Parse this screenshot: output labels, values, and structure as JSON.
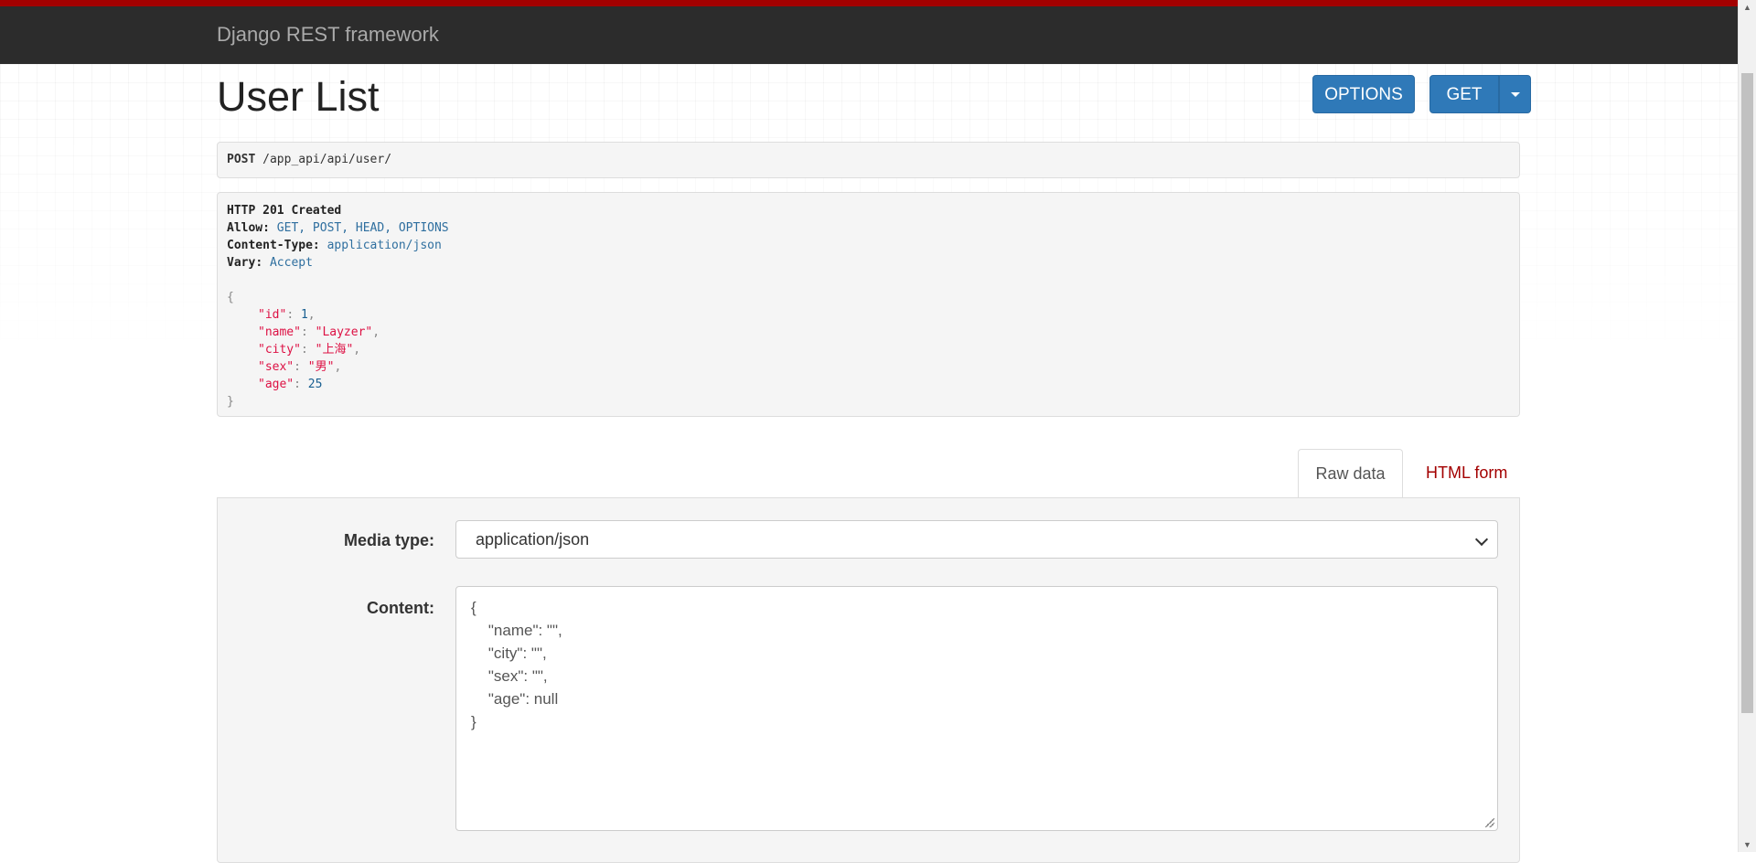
{
  "navbar": {
    "brand": "Django REST framework"
  },
  "header": {
    "title": "User List",
    "options_label": "OPTIONS",
    "get_label": "GET"
  },
  "request": {
    "method": "POST",
    "path": "/app_api/api/user/"
  },
  "response": {
    "status": "HTTP 201 Created",
    "headers": [
      {
        "key": "Allow",
        "value": "GET, POST, HEAD, OPTIONS"
      },
      {
        "key": "Content-Type",
        "value": "application/json"
      },
      {
        "key": "Vary",
        "value": "Accept"
      }
    ],
    "body": {
      "open": "{",
      "fields": [
        {
          "key": "\"id\"",
          "value": "1",
          "kind": "lit",
          "comma": true
        },
        {
          "key": "\"name\"",
          "value": "\"Layzer\"",
          "kind": "str",
          "comma": true
        },
        {
          "key": "\"city\"",
          "value": "\"上海\"",
          "kind": "str",
          "comma": true
        },
        {
          "key": "\"sex\"",
          "value": "\"男\"",
          "kind": "str",
          "comma": true
        },
        {
          "key": "\"age\"",
          "value": "25",
          "kind": "lit",
          "comma": false
        }
      ],
      "close": "}"
    }
  },
  "form": {
    "tabs": [
      {
        "label": "Raw data",
        "active": true
      },
      {
        "label": "HTML form",
        "active": false
      }
    ],
    "media_type_label": "Media type:",
    "media_type_value": "application/json",
    "content_label": "Content:",
    "content_lines": [
      "{",
      "    \"name\": \"\",",
      "    \"city\": \"\",",
      "    \"sex\": \"\",",
      "    \"age\": null",
      "}"
    ]
  },
  "colors": {
    "navbar_bg": "#2c2c2c",
    "navbar_accent": "#a30000",
    "button_primary": "#2f79b8",
    "tab_link": "#a30000"
  }
}
